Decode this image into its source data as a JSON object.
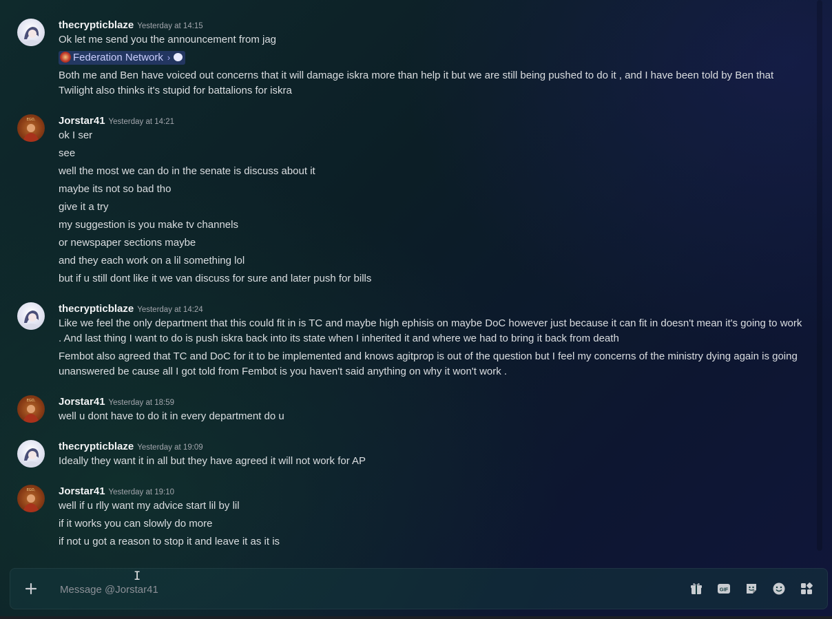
{
  "groups": [
    {
      "username": "thecrypticblaze",
      "timestamp": "Yesterday at 14:15",
      "avatar": "thecrypticblaze-avatar",
      "lines": [
        "Ok let me send you the announcement from jag"
      ],
      "embed": {
        "label": "Federation Network"
      },
      "after_lines": [
        "Both me and Ben have voiced out concerns that it will damage iskra more than help it but we are still being pushed to do it , and I have been told by Ben that Twilight also thinks it's stupid for battalions for iskra"
      ]
    },
    {
      "username": "Jorstar41",
      "timestamp": "Yesterday at 14:21",
      "avatar": "jorstar41-avatar",
      "lines": [
        "ok I ser",
        "see",
        "well the most we can do in the senate is discuss about it",
        "maybe its not so bad tho",
        "give it a try",
        "my suggestion is you make tv channels",
        "or newspaper sections maybe",
        "and they each work on a lil something lol",
        "but if u still dont like it we van discuss for sure and later push for bills"
      ]
    },
    {
      "username": "thecrypticblaze",
      "timestamp": "Yesterday at 14:24",
      "avatar": "thecrypticblaze-avatar",
      "lines": [
        "Like we feel the only department that this could fit in is TC and maybe high ephisis on maybe DoC however just because it can fit in doesn't mean it's going to work . And last thing I want to do is push iskra back into its state when I inherited it and where we had to bring it back from death",
        "Fembot also agreed that TC and DoC for it to be implemented and knows agitprop is out of the question but I feel my concerns of the ministry dying again is going unanswered be cause all I got told from Fembot is you haven't said anything on why it won't work ."
      ]
    },
    {
      "username": "Jorstar41",
      "timestamp": "Yesterday at 18:59",
      "avatar": "jorstar41-avatar",
      "lines": [
        "well u dont have to do it in every department do u"
      ]
    },
    {
      "username": "thecrypticblaze",
      "timestamp": "Yesterday at 19:09",
      "avatar": "thecrypticblaze-avatar",
      "lines": [
        "Ideally they want it in all but they have agreed it will not work for AP"
      ]
    },
    {
      "username": "Jorstar41",
      "timestamp": "Yesterday at 19:10",
      "avatar": "jorstar41-avatar",
      "lines": [
        "well if u rlly want my advice start lil by lil",
        "if it works you can slowly do more",
        "if not u got a reason to stop it and leave it as it is"
      ]
    }
  ],
  "composer": {
    "placeholder": "Message @Jorstar41",
    "add_icon": "plus-circle-icon",
    "tools": [
      "gift-icon",
      "gif-icon",
      "sticker-icon",
      "emoji-icon",
      "apps-icon"
    ]
  },
  "colors": {
    "username": "#f2f3f5",
    "timestamp": "#a3a6ad",
    "text": "#dbdee1",
    "mention_bg": "#5865f2"
  }
}
